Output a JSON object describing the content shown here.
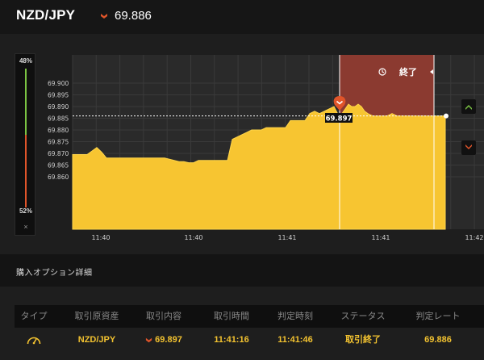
{
  "header": {
    "pair": "NZD/JPY",
    "rate_icon": "down-arrow-icon",
    "rate": "69.886"
  },
  "gauge": {
    "top_pct": "48%",
    "bottom_pct": "52%",
    "close_glyph": "×",
    "colors": {
      "up": "#7bc443",
      "down": "#e0552a"
    }
  },
  "chart_data": {
    "type": "area",
    "y_ticks": [
      "69.900",
      "69.895",
      "69.890",
      "69.885",
      "69.880",
      "69.875",
      "69.870",
      "69.865",
      "69.860"
    ],
    "x_ticks": [
      "11:40",
      "11:40",
      "11:41",
      "11:41",
      "11:42"
    ],
    "ylim": [
      69.855,
      69.903
    ],
    "current_rate": "69.886",
    "entry_label": "69.897",
    "expiry_label": "終了",
    "expiry_icon": "clock-icon",
    "fill_color": "#f7c531",
    "series": [
      {
        "values": [
          [
            0,
            69.8695
          ],
          [
            6,
            69.8695
          ],
          [
            12,
            69.8695
          ],
          [
            18,
            69.8695
          ],
          [
            24,
            69.871
          ],
          [
            30,
            69.8725
          ],
          [
            36,
            69.8705
          ],
          [
            42,
            69.868
          ],
          [
            48,
            69.868
          ],
          [
            54,
            69.868
          ],
          [
            60,
            69.868
          ],
          [
            66,
            69.868
          ],
          [
            72,
            69.868
          ],
          [
            78,
            69.868
          ],
          [
            84,
            69.868
          ],
          [
            90,
            69.868
          ],
          [
            96,
            69.868
          ],
          [
            102,
            69.868
          ],
          [
            108,
            69.868
          ],
          [
            114,
            69.868
          ],
          [
            120,
            69.8675
          ],
          [
            126,
            69.867
          ],
          [
            132,
            69.8665
          ],
          [
            138,
            69.8665
          ],
          [
            144,
            69.866
          ],
          [
            150,
            69.866
          ],
          [
            156,
            69.867
          ],
          [
            162,
            69.867
          ],
          [
            168,
            69.867
          ],
          [
            174,
            69.867
          ],
          [
            180,
            69.867
          ],
          [
            186,
            69.867
          ],
          [
            192,
            69.867
          ],
          [
            198,
            69.876
          ],
          [
            204,
            69.877
          ],
          [
            210,
            69.878
          ],
          [
            216,
            69.879
          ],
          [
            222,
            69.88
          ],
          [
            228,
            69.88
          ],
          [
            234,
            69.88
          ],
          [
            240,
            69.881
          ],
          [
            246,
            69.881
          ],
          [
            252,
            69.881
          ],
          [
            258,
            69.881
          ],
          [
            264,
            69.881
          ],
          [
            270,
            69.884
          ],
          [
            276,
            69.884
          ],
          [
            282,
            69.884
          ],
          [
            288,
            69.884
          ],
          [
            294,
            69.887
          ],
          [
            300,
            69.888
          ],
          [
            306,
            69.887
          ],
          [
            312,
            69.888
          ],
          [
            318,
            69.889
          ],
          [
            324,
            69.89
          ],
          [
            330,
            69.886
          ],
          [
            334,
            69.887
          ],
          [
            338,
            69.889
          ],
          [
            342,
            69.891
          ],
          [
            346,
            69.89
          ],
          [
            350,
            69.89
          ],
          [
            354,
            69.891
          ],
          [
            358,
            69.89
          ],
          [
            362,
            69.888
          ],
          [
            366,
            69.887
          ],
          [
            372,
            69.886
          ],
          [
            378,
            69.886
          ],
          [
            384,
            69.886
          ],
          [
            390,
            69.886
          ],
          [
            396,
            69.887
          ],
          [
            402,
            69.886
          ],
          [
            408,
            69.886
          ],
          [
            414,
            69.886
          ],
          [
            420,
            69.886
          ],
          [
            426,
            69.886
          ],
          [
            432,
            69.886
          ],
          [
            438,
            69.886
          ],
          [
            444,
            69.886
          ],
          [
            450,
            69.886
          ],
          [
            456,
            69.886
          ],
          [
            462,
            69.886
          ]
        ]
      }
    ]
  },
  "side_buttons": {
    "up_icon": "up-chevron-icon",
    "down_icon": "down-chevron-icon"
  },
  "section": {
    "title": "購入オプション詳細"
  },
  "table": {
    "headers": [
      "タイプ",
      "取引原資産",
      "取引内容",
      "取引時間",
      "判定時刻",
      "ステータス",
      "判定レート"
    ],
    "row": {
      "type_icon": "gauge-icon",
      "asset": "NZD/JPY",
      "direction_icon": "down-arrow-icon",
      "entry_rate": "69.897",
      "trade_time": "11:41:16",
      "judge_time": "11:41:46",
      "status": "取引終了",
      "judge_rate": "69.886"
    },
    "text_color": "#f2c230"
  }
}
